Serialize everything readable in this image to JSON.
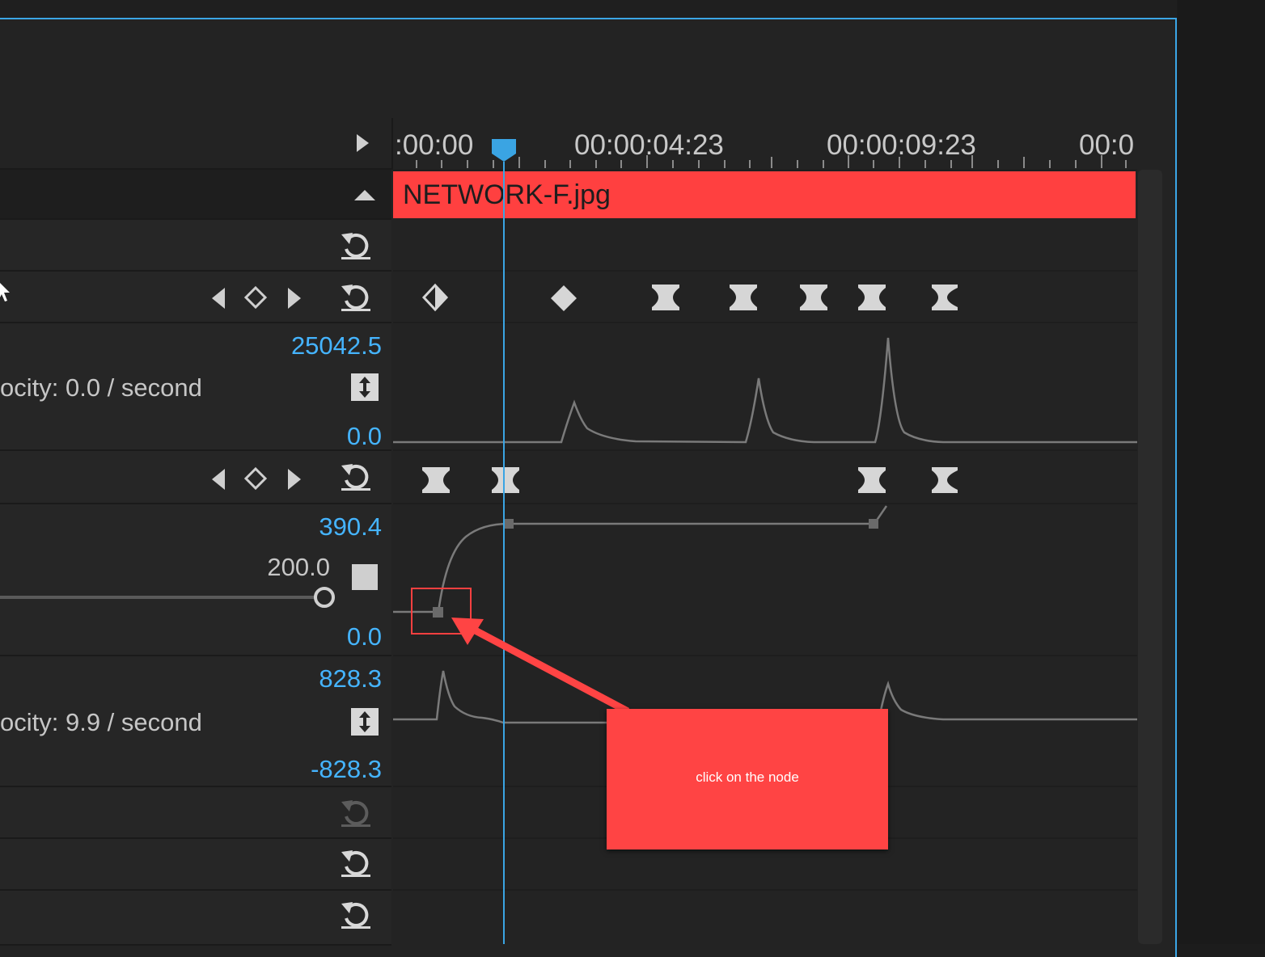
{
  "timeline": {
    "ruler": {
      "labels": [
        ":00:00",
        "00:00:04:23",
        "00:00:09:23",
        "00:0"
      ]
    },
    "clip": {
      "name": "NETWORK-F.jpg"
    }
  },
  "effects": {
    "position_graph": {
      "max": "25042.5",
      "min": "0.0",
      "velocity_label": "ocity: 0.0 / second"
    },
    "scale_graph": {
      "max": "390.4",
      "current": "200.0",
      "min": "0.0"
    },
    "velocity_graph": {
      "max": "828.3",
      "min": "-828.3",
      "velocity_label": "ocity: 9.9 / second"
    }
  },
  "annotation": {
    "callout_text": "click on the node",
    "color": "#ff4444"
  },
  "colors": {
    "accent": "#3ba6e6",
    "value": "#45b4ff",
    "clip": "#ff4040"
  }
}
